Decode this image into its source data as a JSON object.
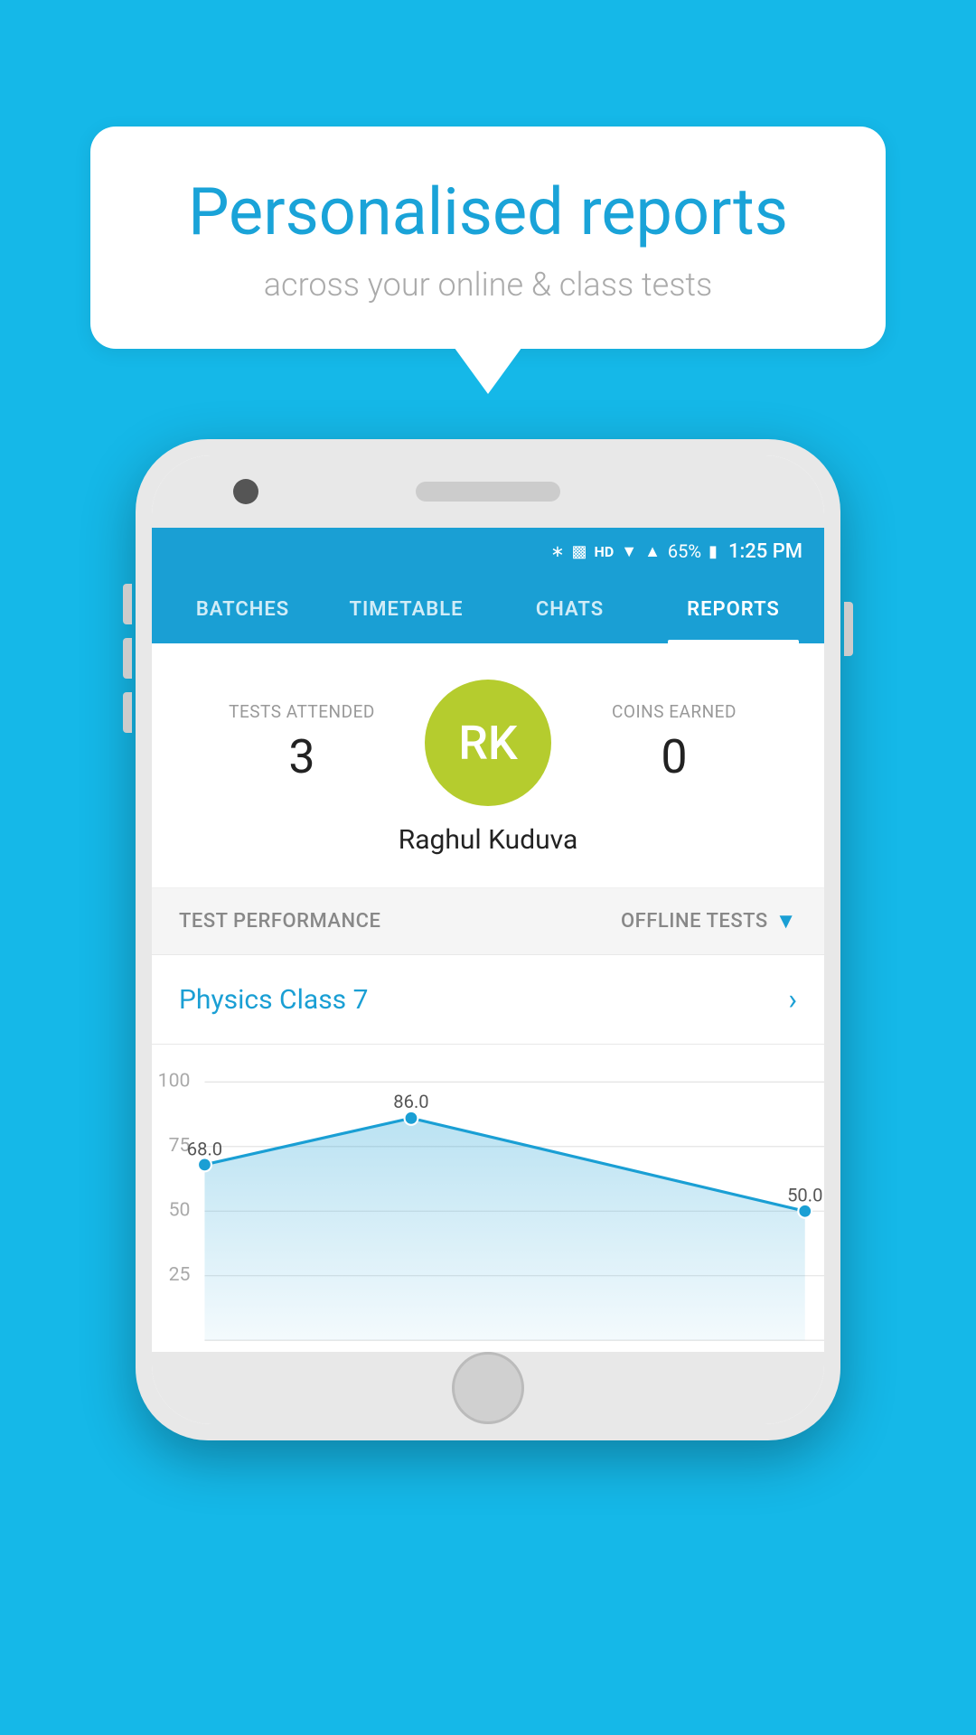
{
  "bubble": {
    "title": "Personalised reports",
    "subtitle": "across your online & class tests"
  },
  "status_bar": {
    "battery_percent": "65%",
    "time": "1:25 PM"
  },
  "nav_tabs": [
    {
      "label": "BATCHES",
      "active": false
    },
    {
      "label": "TIMETABLE",
      "active": false
    },
    {
      "label": "CHATS",
      "active": false
    },
    {
      "label": "REPORTS",
      "active": true
    }
  ],
  "profile": {
    "tests_attended_label": "TESTS ATTENDED",
    "tests_attended_value": "3",
    "coins_earned_label": "COINS EARNED",
    "coins_earned_value": "0",
    "avatar_initials": "RK",
    "user_name": "Raghul Kuduva"
  },
  "performance": {
    "section_label": "TEST PERFORMANCE",
    "filter_label": "OFFLINE TESTS",
    "class_name": "Physics Class 7"
  },
  "chart": {
    "y_labels": [
      "100",
      "75",
      "50",
      "25"
    ],
    "data_points": [
      {
        "x": 10,
        "y": 68,
        "label": "68.0"
      },
      {
        "x": 35,
        "y": 86,
        "label": "86.0"
      },
      {
        "x": 90,
        "y": 50,
        "label": "50.0"
      }
    ]
  }
}
